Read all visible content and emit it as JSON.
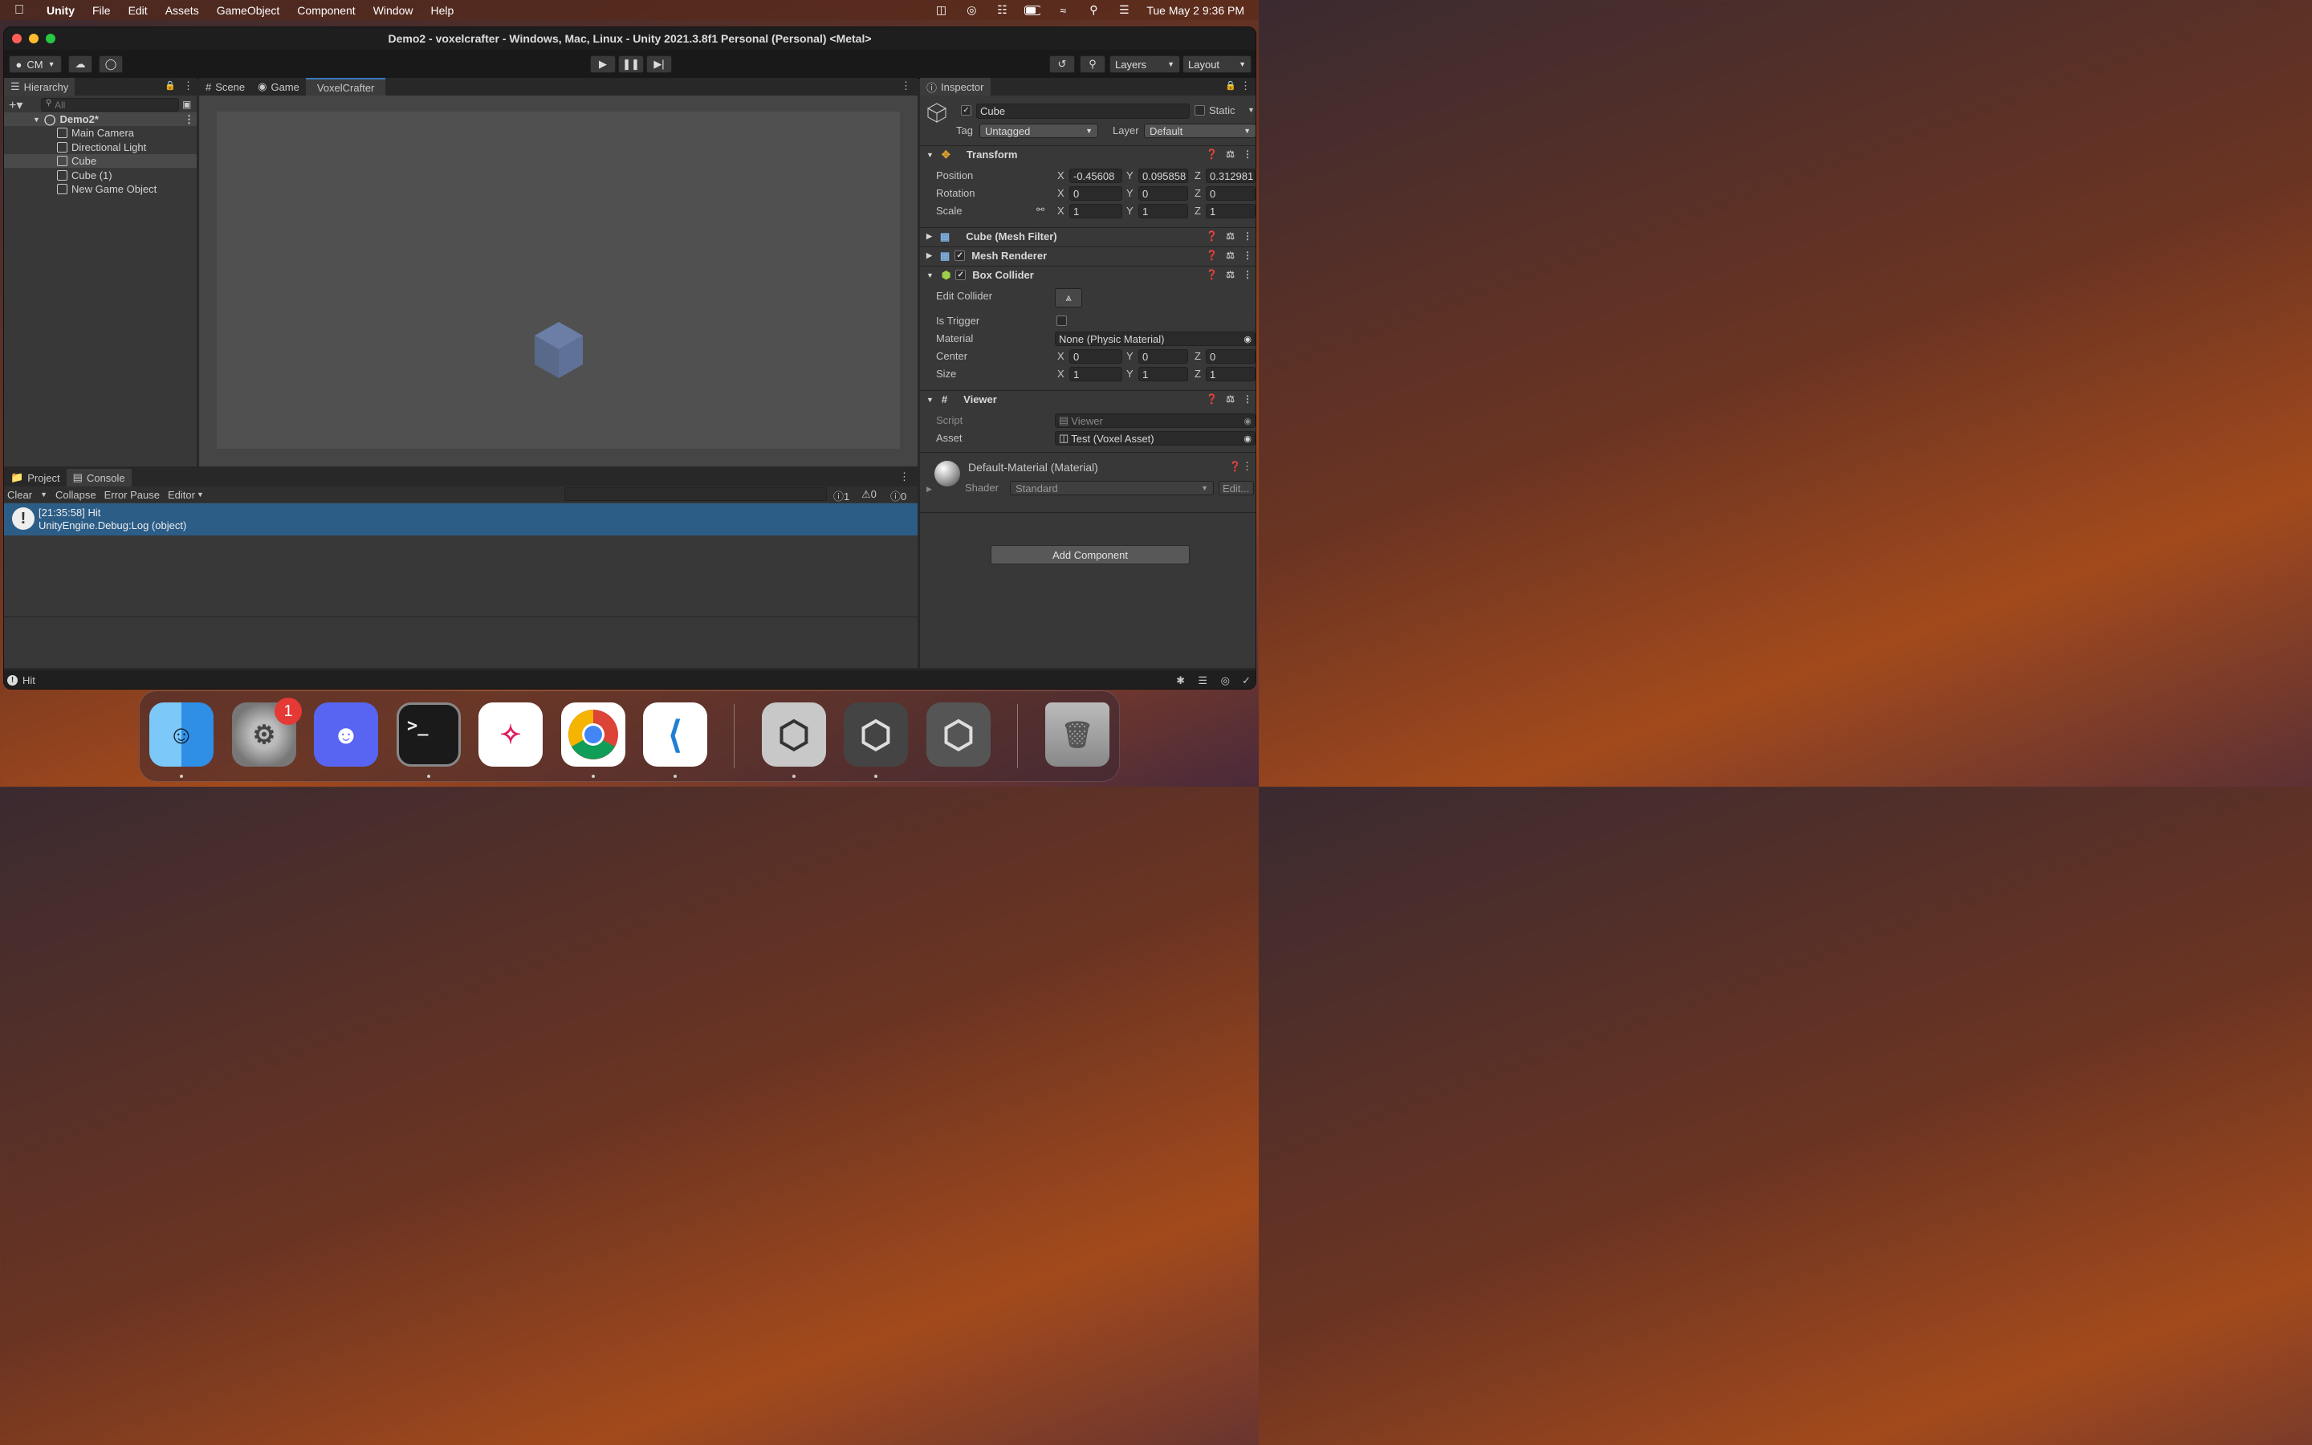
{
  "menubar": {
    "apple_icon": "apple-logo-icon",
    "app": "Unity",
    "items": [
      "File",
      "Edit",
      "Assets",
      "GameObject",
      "Component",
      "Window",
      "Help"
    ],
    "clock": "Tue May 2  9:36 PM"
  },
  "window": {
    "title": "Demo2 - voxelcrafter - Windows, Mac, Linux - Unity 2021.3.8f1 Personal (Personal) <Metal>"
  },
  "toolbar": {
    "account": "CM",
    "layers": "Layers",
    "layout": "Layout"
  },
  "hierarchy": {
    "tab": "Hierarchy",
    "search_placeholder": "All",
    "scene": "Demo2*",
    "items": [
      "Main Camera",
      "Directional Light",
      "Cube",
      "Cube (1)",
      "New Game Object"
    ],
    "selected": "Cube"
  },
  "center_tabs": [
    "Scene",
    "Game",
    "VoxelCrafter"
  ],
  "bottom": {
    "tabs": [
      "Project",
      "Console"
    ],
    "buttons": {
      "clear": "Clear",
      "collapse": "Collapse",
      "error_pause": "Error Pause",
      "editor": "Editor"
    },
    "counts": {
      "errors": "1",
      "warnings": "0",
      "info": "0"
    },
    "log_line1": "[21:35:58] Hit",
    "log_line2": "UnityEngine.Debug:Log (object)",
    "status": "Hit"
  },
  "inspector": {
    "tab": "Inspector",
    "name": "Cube",
    "static": "Static",
    "tag_label": "Tag",
    "tag": "Untagged",
    "layer_label": "Layer",
    "layer": "Default",
    "transform": {
      "title": "Transform",
      "position_label": "Position",
      "rotation_label": "Rotation",
      "scale_label": "Scale",
      "position": {
        "x": "-0.45608",
        "y": "0.095858",
        "z": "0.312981"
      },
      "rotation": {
        "x": "0",
        "y": "0",
        "z": "0"
      },
      "scale": {
        "x": "1",
        "y": "1",
        "z": "1"
      }
    },
    "mesh_filter": "Cube (Mesh Filter)",
    "mesh_renderer": "Mesh Renderer",
    "box_collider": {
      "title": "Box Collider",
      "edit_label": "Edit Collider",
      "trigger_label": "Is Trigger",
      "material_label": "Material",
      "material": "None (Physic Material)",
      "center_label": "Center",
      "size_label": "Size",
      "center": {
        "x": "0",
        "y": "0",
        "z": "0"
      },
      "size": {
        "x": "1",
        "y": "1",
        "z": "1"
      }
    },
    "viewer": {
      "title": "Viewer",
      "script_label": "Script",
      "script": "Viewer",
      "asset_label": "Asset",
      "asset": "Test (Voxel Asset)"
    },
    "material": {
      "name": "Default-Material (Material)",
      "shader_label": "Shader",
      "shader": "Standard",
      "edit": "Edit..."
    },
    "add_component": "Add Component"
  },
  "axis": {
    "x": "X",
    "y": "Y",
    "z": "Z"
  },
  "dock": {
    "apps": [
      "finder-icon",
      "system-settings-icon",
      "discord-icon",
      "terminal-icon",
      "slack-icon",
      "chrome-icon",
      "vscode-icon",
      "unity-icon",
      "unity-icon",
      "unity-icon",
      "trash-icon"
    ],
    "badge": "1",
    "terminal_glyph": ">_"
  }
}
